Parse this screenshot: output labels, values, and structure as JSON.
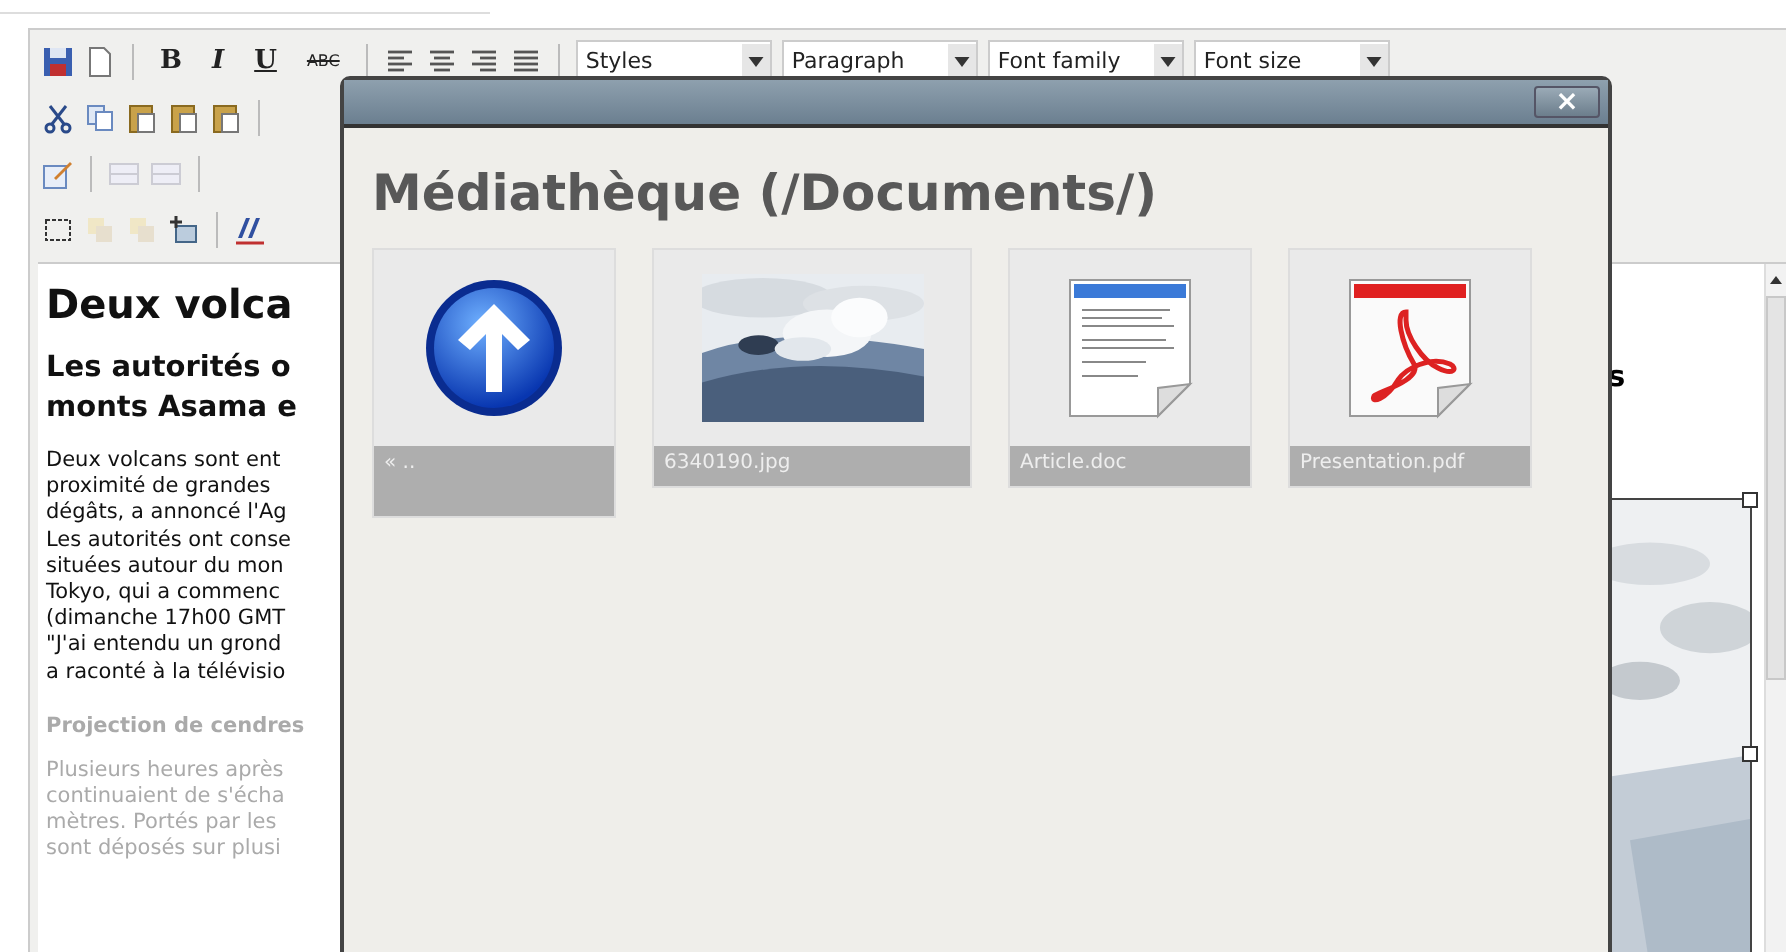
{
  "toolbar": {
    "format_buttons": [
      {
        "label": "B",
        "kind": "bold"
      },
      {
        "label": "I",
        "kind": "italic"
      },
      {
        "label": "U",
        "kind": "underline"
      },
      {
        "label": "ABC",
        "kind": "strike"
      }
    ],
    "dropdowns": [
      {
        "label": "Styles"
      },
      {
        "label": "Paragraph"
      },
      {
        "label": "Font family"
      },
      {
        "label": "Font size"
      }
    ]
  },
  "document": {
    "heading": "Deux volca",
    "subheading_lines": [
      "Les autorités o",
      "monts Asama e"
    ],
    "subheading_tail": "s",
    "paragraph_lines": [
      "Deux volcans sont ent",
      "proximité de grandes",
      "dégâts, a annoncé l'Ag",
      "Les autorités ont conse",
      "situées autour du mon",
      "Tokyo, qui a commenc",
      "(dimanche 17h00 GMT",
      "\"J'ai entendu un grond",
      "a raconté à la télévisio"
    ],
    "section_heading": "Projection de cendres",
    "faded_lines": [
      "Plusieurs heures après",
      "continuaient de s'écha",
      "mètres. Portés par les",
      "sont déposés sur plusi"
    ]
  },
  "dialog": {
    "close": "×",
    "title": "Médiathèque (/Documents/)",
    "files": [
      {
        "kind": "parent",
        "name": "« .."
      },
      {
        "name": "6340190.jpg"
      },
      {
        "kind": "doc",
        "name": "Article.doc"
      },
      {
        "kind": "pdf",
        "name": "Presentation.pdf"
      }
    ]
  }
}
